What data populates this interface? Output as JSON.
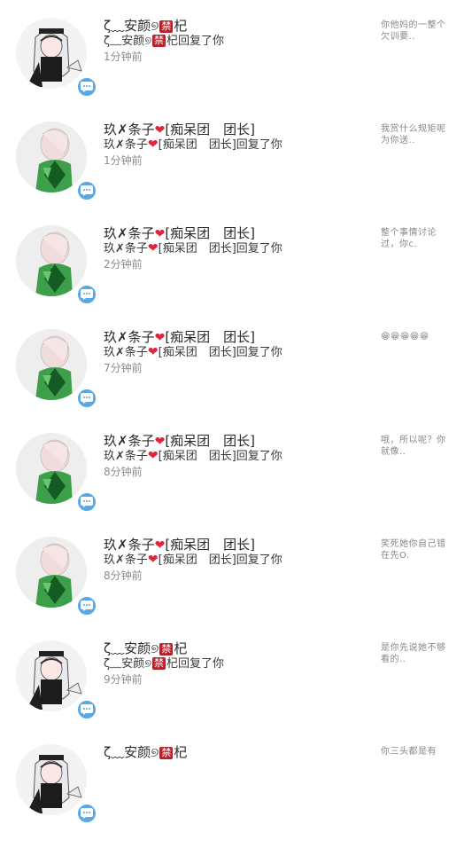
{
  "notifications": [
    {
      "avatar_style": "girl-white-hair",
      "name_prefix": "ζ﹏安颜୭",
      "name_badge": "禁",
      "name_suffix": "杞",
      "reply_prefix": "ζ﹏安颜୭",
      "reply_badge": "禁",
      "reply_suffix": "杞回复了你",
      "time": "1分钟前",
      "preview": "你他妈的一整个欠训要.."
    },
    {
      "avatar_style": "green-figure",
      "name_prefix": "玖✗条子",
      "name_heart": "❤",
      "name_suffix": "[痴呆团　团长]",
      "reply_prefix": "玖✗条子",
      "reply_heart": "❤",
      "reply_suffix": "[痴呆团　团长]回复了你",
      "time": "1分钟前",
      "preview": "我赏什么规矩呢为你送.."
    },
    {
      "avatar_style": "green-figure",
      "name_prefix": "玖✗条子",
      "name_heart": "❤",
      "name_suffix": "[痴呆团　团长]",
      "reply_prefix": "玖✗条子",
      "reply_heart": "❤",
      "reply_suffix": "[痴呆团　团长]回复了你",
      "time": "2分钟前",
      "preview": "整个事情讨论过，你c."
    },
    {
      "avatar_style": "green-figure",
      "name_prefix": "玖✗条子",
      "name_heart": "❤",
      "name_suffix": "[痴呆团　团长]",
      "reply_prefix": "玖✗条子",
      "reply_heart": "❤",
      "reply_suffix": "[痴呆团　团长]回复了你",
      "time": "7分钟前",
      "preview": "😁😁😁😁😁"
    },
    {
      "avatar_style": "green-figure",
      "name_prefix": "玖✗条子",
      "name_heart": "❤",
      "name_suffix": "[痴呆团　团长]",
      "reply_prefix": "玖✗条子",
      "reply_heart": "❤",
      "reply_suffix": "[痴呆团　团长]回复了你",
      "time": "8分钟前",
      "preview": "哦，所以呢？你就像.."
    },
    {
      "avatar_style": "green-figure",
      "name_prefix": "玖✗条子",
      "name_heart": "❤",
      "name_suffix": "[痴呆团　团长]",
      "reply_prefix": "玖✗条子",
      "reply_heart": "❤",
      "reply_suffix": "[痴呆团　团长]回复了你",
      "time": "8分钟前",
      "preview": "笑死她你自己错在先O."
    },
    {
      "avatar_style": "girl-white-hair",
      "name_prefix": "ζ﹏安颜୭",
      "name_badge": "禁",
      "name_suffix": "杞",
      "reply_prefix": "ζ﹏安颜୭",
      "reply_badge": "禁",
      "reply_suffix": "杞回复了你",
      "time": "9分钟前",
      "preview": "是你先说她不够看的.."
    },
    {
      "avatar_style": "girl-white-hair",
      "name_prefix": "ζ﹏安颜୭",
      "name_badge": "禁",
      "name_suffix": "杞",
      "reply_prefix": "",
      "reply_badge": "",
      "reply_suffix": "",
      "time": "",
      "preview": "你三头都是有"
    }
  ],
  "colors": {
    "badge_blue": "#58a8e6",
    "ban_red": "#b3232e",
    "heart_red": "#e0243a"
  },
  "icons": {
    "badge": "chat-bubble-icon"
  }
}
